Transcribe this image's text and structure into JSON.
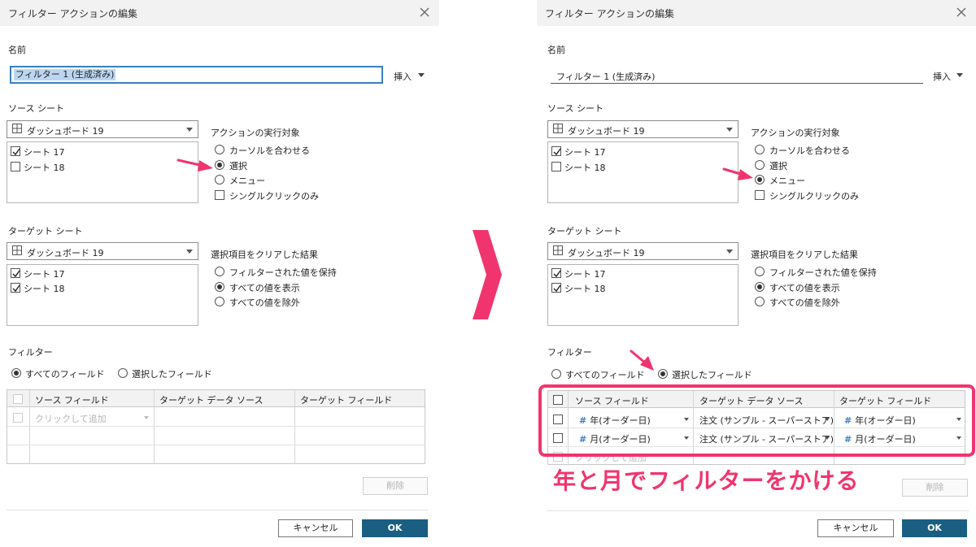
{
  "left_dialog": {
    "title": "フィルター アクションの編集",
    "name_label": "名前",
    "name_value": "フィルター 1 (生成済み)",
    "insert_label": "挿入",
    "source_sheet_label": "ソース シート",
    "source_dashboard": "ダッシュボード 19",
    "source_sheets": [
      {
        "label": "シート 17",
        "checked": true
      },
      {
        "label": "シート 18",
        "checked": false
      }
    ],
    "run_action_label": "アクションの実行対象",
    "run_options": [
      "カーソルを合わせる",
      "選択",
      "メニュー"
    ],
    "run_selected": 1,
    "single_click_label": "シングルクリックのみ",
    "target_sheet_label": "ターゲット シート",
    "target_dashboard": "ダッシュボード 19",
    "target_sheets": [
      {
        "label": "シート 17",
        "checked": true
      },
      {
        "label": "シート 18",
        "checked": true
      }
    ],
    "clear_result_label": "選択項目をクリアした結果",
    "clear_options": [
      "フィルターされた値を保持",
      "すべての値を表示",
      "すべての値を除外"
    ],
    "clear_selected": 1,
    "filter_label": "フィルター",
    "filter_options": [
      "すべてのフィールド",
      "選択したフィールド"
    ],
    "filter_selected": 0,
    "grid_headers": [
      "ソース フィールド",
      "ターゲット データ ソース",
      "ターゲット フィールド"
    ],
    "grid_placeholder": "クリックして追加",
    "delete_label": "削除",
    "cancel_label": "キャンセル",
    "ok_label": "OK"
  },
  "right_dialog": {
    "title": "フィルター アクションの編集",
    "name_label": "名前",
    "name_value": "フィルター 1 (生成済み)",
    "insert_label": "挿入",
    "source_sheet_label": "ソース シート",
    "source_dashboard": "ダッシュボード 19",
    "source_sheets": [
      {
        "label": "シート 17",
        "checked": true
      },
      {
        "label": "シート 18",
        "checked": false
      }
    ],
    "run_action_label": "アクションの実行対象",
    "run_options": [
      "カーソルを合わせる",
      "選択",
      "メニュー"
    ],
    "run_selected": 2,
    "single_click_label": "シングルクリックのみ",
    "target_sheet_label": "ターゲット シート",
    "target_dashboard": "ダッシュボード 19",
    "target_sheets": [
      {
        "label": "シート 17",
        "checked": true
      },
      {
        "label": "シート 18",
        "checked": true
      }
    ],
    "clear_result_label": "選択項目をクリアした結果",
    "clear_options": [
      "フィルターされた値を保持",
      "すべての値を表示",
      "すべての値を除外"
    ],
    "clear_selected": 1,
    "filter_label": "フィルター",
    "filter_options": [
      "すべてのフィールド",
      "選択したフィールド"
    ],
    "filter_selected": 1,
    "grid_headers": [
      "ソース フィールド",
      "ターゲット データ ソース",
      "ターゲット フィールド"
    ],
    "grid_rows": [
      {
        "source": "年(オーダー日)",
        "datasource": "注文 (サンプル - スーパーストア)",
        "target": "年(オーダー日)"
      },
      {
        "source": "月(オーダー日)",
        "datasource": "注文 (サンプル - スーパーストア)",
        "target": "月(オーダー日)"
      }
    ],
    "grid_placeholder": "クリックして追加",
    "delete_label": "削除",
    "cancel_label": "キャンセル",
    "ok_label": "OK"
  },
  "annotation": {
    "text": "年と月でフィルターをかける",
    "color": "#f0356e"
  },
  "colors": {
    "ok_button": "#1a5f82",
    "highlight": "#f0356e",
    "titlebar": "#f2f2f2"
  }
}
